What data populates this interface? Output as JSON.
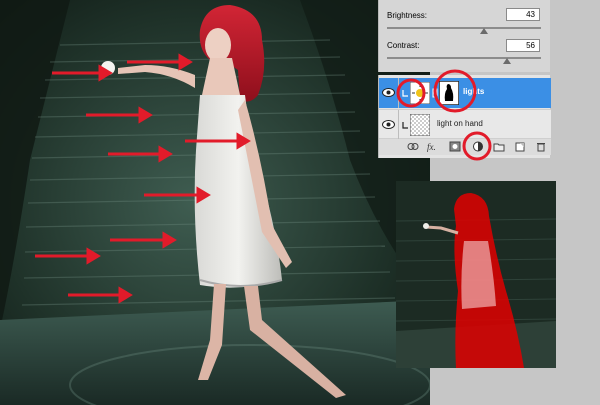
{
  "adjustments": {
    "brightness_label": "Brightness:",
    "brightness_value": "43",
    "contrast_label": "Contrast:",
    "contrast_value": "56"
  },
  "layers": [
    {
      "name": "lights",
      "selected": true,
      "icon": "brightness-contrast-adjustment-icon"
    },
    {
      "name": "light on hand",
      "selected": false,
      "icon": "transparent-thumbnail"
    }
  ],
  "toolbar_icons": [
    "link-icon",
    "fx-icon",
    "mask-icon",
    "adjustment-layer-icon",
    "folder-icon",
    "new-layer-icon",
    "trash-icon"
  ],
  "colors": {
    "selection_blue": "#3b8fe5",
    "annotation_red": "#e21b2a",
    "panel_gray": "#d6d6d6",
    "mask_overlay_red": "#e00000"
  }
}
